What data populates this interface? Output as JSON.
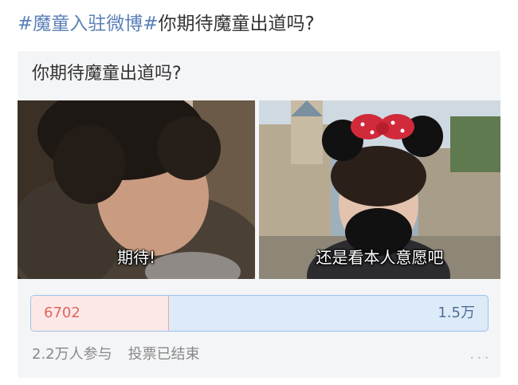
{
  "post": {
    "hashtag": "#魔童入驻微博#",
    "text": "你期待魔童出道吗?"
  },
  "vote": {
    "title": "你期待魔童出道吗?",
    "options": [
      {
        "caption": "期待!",
        "count": "6702"
      },
      {
        "caption": "还是看本人意愿吧",
        "count": "1.5万"
      }
    ],
    "share_left": 0.3,
    "participants": "2.2万人参与",
    "status": "投票已结束"
  },
  "colors": {
    "hashtag": "#5b7fb6",
    "left_bar_bg": "#fde8e8",
    "left_bar_text": "#e0665b",
    "right_bar_bg": "#ddeaf8",
    "right_bar_border": "#9cc3ea",
    "right_bar_text": "#4f6f95"
  }
}
